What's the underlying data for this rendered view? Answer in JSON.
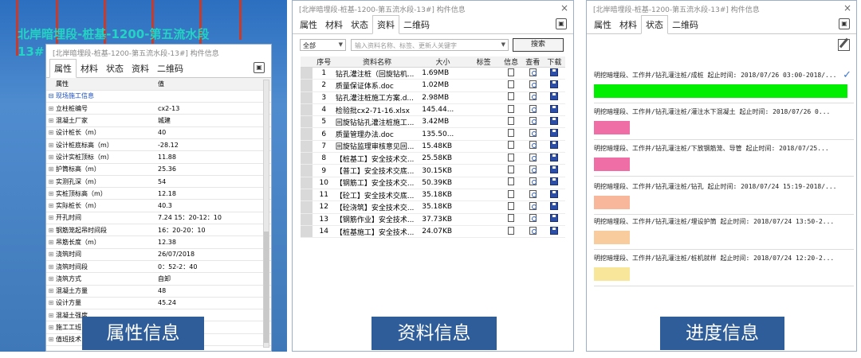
{
  "panel1": {
    "bim_title_line1": "北岸暗埋段-桩基-1200-第五流水段",
    "bim_title_line2": "13#",
    "window_title": "[北岸暗埋段-桩基-1200-第五流水段-13#] 构件信息",
    "tabs": [
      "属性",
      "材料",
      "状态",
      "资料",
      "二维码"
    ],
    "active_tab": "属性",
    "header": {
      "col_property": "属性",
      "col_value": "值"
    },
    "group": "现场施工信息",
    "rows": [
      {
        "label": "立柱桩编号",
        "value": "cx2-13"
      },
      {
        "label": "混凝土厂家",
        "value": "城建"
      },
      {
        "label": "设计桩长（m）",
        "value": "40"
      },
      {
        "label": "设计桩底标高（m）",
        "value": "-28.12"
      },
      {
        "label": "设计实桩顶标（m）",
        "value": "11.88"
      },
      {
        "label": "护筒标高（m）",
        "value": "25.36"
      },
      {
        "label": "实测孔深（m）",
        "value": "54"
      },
      {
        "label": "实桩顶标高（m）",
        "value": "12.18"
      },
      {
        "label": "实际桩长（m）",
        "value": "40.3"
      },
      {
        "label": "开孔时间",
        "value": "7.24 15：20-12：10"
      },
      {
        "label": "钢筋笼起吊时间段",
        "value": "16：20-20：10"
      },
      {
        "label": "吊筋长度（m）",
        "value": "12.38"
      },
      {
        "label": "浇筑时间",
        "value": "26/07/2018"
      },
      {
        "label": "浇筑时间段",
        "value": "0：52-2：40"
      },
      {
        "label": "浇筑方式",
        "value": "自卸"
      },
      {
        "label": "混凝土方量",
        "value": "48"
      },
      {
        "label": "设计方量",
        "value": "45.24"
      },
      {
        "label": "混凝土强度",
        "value": ""
      },
      {
        "label": "施工工班",
        "value": ""
      },
      {
        "label": "值班技术",
        "value": ""
      }
    ],
    "caption": "属性信息"
  },
  "panel2": {
    "window_title": "[北岸暗埋段-桩基-1200-第五流水段-13#] 构件信息",
    "tabs": [
      "属性",
      "材料",
      "状态",
      "资料",
      "二维码"
    ],
    "active_tab": "资料",
    "filter_value": "全部",
    "search_placeholder": "输入资料名称、标签、更新人关键字",
    "search_button": "搜索",
    "columns": [
      "序号",
      "资料名称",
      "大小",
      "标签",
      "信息",
      "查看",
      "下载"
    ],
    "files": [
      {
        "n": "1",
        "name": "钻孔灌注桩（回旋钻机...",
        "size": "1.69MB"
      },
      {
        "n": "2",
        "name": "质量保证体系.doc",
        "size": "1.02MB"
      },
      {
        "n": "3",
        "name": "钻孔灌注桩施工方案.d...",
        "size": "2.98MB"
      },
      {
        "n": "4",
        "name": "检验批cx2-71-16.xlsx",
        "size": "145.44..."
      },
      {
        "n": "5",
        "name": "回旋钻钻孔灌注桩施工...",
        "size": "3.42MB"
      },
      {
        "n": "6",
        "name": "质量管理办法.doc",
        "size": "135.50..."
      },
      {
        "n": "7",
        "name": "回旋钻监理审核意见回...",
        "size": "15.48KB"
      },
      {
        "n": "8",
        "name": "【桩基工】安全技术交...",
        "size": "25.58KB"
      },
      {
        "n": "9",
        "name": "【普工】安全技术交底...",
        "size": "30.15KB"
      },
      {
        "n": "10",
        "name": "【钢筋工】安全技术交...",
        "size": "50.39KB"
      },
      {
        "n": "11",
        "name": "【砼工】安全技术交底...",
        "size": "35.18KB"
      },
      {
        "n": "12",
        "name": "【砼浇筑】安全技术交...",
        "size": "35.18KB"
      },
      {
        "n": "13",
        "name": "【钢筋作业】安全技术...",
        "size": "37.73KB"
      },
      {
        "n": "14",
        "name": "【桩基施工】安全技术...",
        "size": "24.07KB"
      }
    ],
    "caption": "资料信息"
  },
  "panel3": {
    "window_title": "[北岸暗埋段-桩基-1200-第五流水段-13#] 构件信息",
    "tabs": [
      "属性",
      "材料",
      "状态",
      "二维码"
    ],
    "active_tab": "状态",
    "entries": [
      {
        "text": "明挖暗埋段、工作井/钻孔灌注桩/成桩  起止时间: 2018/07/26 03:00-2018/...",
        "color": "#00ee00",
        "fill": 1.0
      },
      {
        "text": "明挖暗埋段、工作井/钻孔灌注桩/灌注水下混凝土  起止时间: 2018/07/26 0...",
        "color": "#f06ea6",
        "fill": 0.14
      },
      {
        "text": "明挖暗埋段、工作井/钻孔灌注桩/下放钢筋笼、导管  起止时间: 2018/07/25...",
        "color": "#f06ea6",
        "fill": 0.14
      },
      {
        "text": "明挖暗埋段、工作井/钻孔灌注桩/钻孔  起止时间: 2018/07/24 15:19-2018/...",
        "color": "#f8b79a",
        "fill": 0.14
      },
      {
        "text": "明挖暗埋段、工作井/钻孔灌注桩/埋设护筒  起止时间: 2018/07/24 13:50-2...",
        "color": "#f9cc9e",
        "fill": 0.14
      },
      {
        "text": "明挖暗埋段、工作井/钻孔灌注桩/桩机就样  起止时间: 2018/07/24 12:20-2...",
        "color": "#f8e79a",
        "fill": 0.14
      }
    ],
    "caption": "进度信息"
  }
}
